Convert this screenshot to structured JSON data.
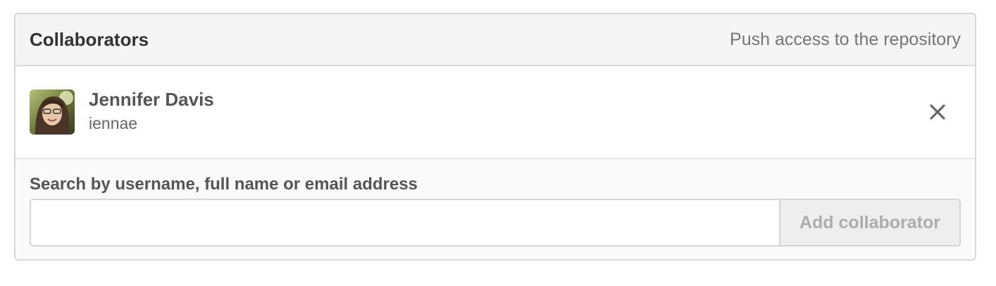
{
  "panel": {
    "title": "Collaborators",
    "subtitle": "Push access to the repository"
  },
  "collaborators": [
    {
      "name": "Jennifer Davis",
      "login": "iennae",
      "avatar": "user-avatar-photo"
    }
  ],
  "add_form": {
    "label": "Search by username, full name or email address",
    "input_value": "",
    "input_placeholder": "",
    "button_label": "Add collaborator"
  },
  "icons": {
    "remove": "close-icon"
  },
  "colors": {
    "header_bg": "#f5f5f5",
    "border": "#d8d8d8",
    "button_text_disabled": "#adadad"
  }
}
